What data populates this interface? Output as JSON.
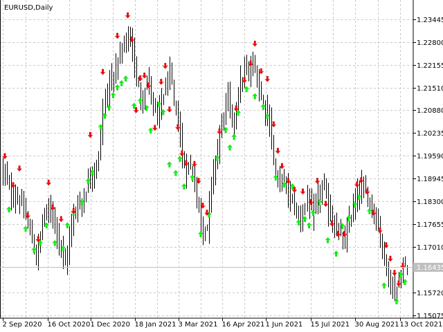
{
  "window": {
    "symbol_title": "EURUSD,Daily"
  },
  "colors": {
    "background": "#ffffff",
    "grid": "#c8c8c8",
    "bar": "#000000",
    "up_arrow": "#00ff00",
    "down_arrow": "#ff0000",
    "price_line": "#c0c0c0",
    "price_tag_bg": "#c0c0c0",
    "price_tag_text": "#ffffff"
  },
  "icons": {
    "up_marker": "green-up-arrow-icon",
    "down_marker": "red-down-arrow-icon"
  },
  "chart_data": {
    "type": "ohlc",
    "title": "EURUSD,Daily",
    "ylim": [
      1.1495,
      1.2385
    ],
    "y_ticks": [
      "1.23445",
      "1.22800",
      "1.22155",
      "1.21510",
      "1.20880",
      "1.20235",
      "1.19590",
      "1.18945",
      "1.18300",
      "1.17655",
      "1.17010",
      "1.16435",
      "1.15720",
      "1.15075"
    ],
    "x_ticks": [
      "2 Sep 2020",
      "16 Oct 2020",
      "1 Dec 2020",
      "18 Jan 2021",
      "3 Mar 2021",
      "16 Apr 2021",
      "1 Jun 2021",
      "15 Jul 2021",
      "30 Aug 2021",
      "13 Oct 2021"
    ],
    "current_price": "1.16435",
    "grid": true,
    "series": [
      {
        "name": "",
        "close_waypoints": [
          [
            0,
            1.192
          ],
          [
            4,
            1.185
          ],
          [
            8,
            1.183
          ],
          [
            12,
            1.177
          ],
          [
            16,
            1.167
          ],
          [
            20,
            1.18
          ],
          [
            24,
            1.18
          ],
          [
            28,
            1.169
          ],
          [
            30,
            1.165
          ],
          [
            34,
            1.18
          ],
          [
            38,
            1.183
          ],
          [
            42,
            1.19
          ],
          [
            46,
            1.195
          ],
          [
            48,
            1.21
          ],
          [
            52,
            1.218
          ],
          [
            56,
            1.224
          ],
          [
            60,
            1.23
          ],
          [
            62,
            1.225
          ],
          [
            64,
            1.218
          ],
          [
            66,
            1.212
          ],
          [
            68,
            1.215
          ],
          [
            70,
            1.217
          ],
          [
            72,
            1.21
          ],
          [
            74,
            1.206
          ],
          [
            76,
            1.212
          ],
          [
            78,
            1.215
          ],
          [
            80,
            1.219
          ],
          [
            82,
            1.211
          ],
          [
            84,
            1.206
          ],
          [
            86,
            1.195
          ],
          [
            88,
            1.192
          ],
          [
            90,
            1.193
          ],
          [
            92,
            1.188
          ],
          [
            94,
            1.18
          ],
          [
            96,
            1.175
          ],
          [
            98,
            1.176
          ],
          [
            100,
            1.188
          ],
          [
            102,
            1.195
          ],
          [
            104,
            1.202
          ],
          [
            106,
            1.208
          ],
          [
            108,
            1.213
          ],
          [
            110,
            1.205
          ],
          [
            112,
            1.211
          ],
          [
            114,
            1.216
          ],
          [
            116,
            1.22
          ],
          [
            118,
            1.219
          ],
          [
            120,
            1.222
          ],
          [
            122,
            1.218
          ],
          [
            124,
            1.212
          ],
          [
            126,
            1.21
          ],
          [
            128,
            1.205
          ],
          [
            130,
            1.195
          ],
          [
            132,
            1.188
          ],
          [
            134,
            1.19
          ],
          [
            136,
            1.187
          ],
          [
            138,
            1.184
          ],
          [
            140,
            1.182
          ],
          [
            142,
            1.178
          ],
          [
            144,
            1.18
          ],
          [
            146,
            1.184
          ],
          [
            148,
            1.179
          ],
          [
            150,
            1.182
          ],
          [
            152,
            1.186
          ],
          [
            154,
            1.187
          ],
          [
            156,
            1.181
          ],
          [
            158,
            1.177
          ],
          [
            160,
            1.175
          ],
          [
            162,
            1.173
          ],
          [
            164,
            1.171
          ],
          [
            166,
            1.178
          ],
          [
            168,
            1.181
          ],
          [
            170,
            1.185
          ],
          [
            172,
            1.187
          ],
          [
            174,
            1.185
          ],
          [
            176,
            1.183
          ],
          [
            178,
            1.18
          ],
          [
            180,
            1.176
          ],
          [
            182,
            1.17
          ],
          [
            184,
            1.164
          ],
          [
            186,
            1.16
          ],
          [
            188,
            1.157
          ],
          [
            190,
            1.16
          ],
          [
            192,
            1.164
          ],
          [
            194,
            1.1643
          ]
        ],
        "up_markers": [
          [
            3,
            1.1815
          ],
          [
            11,
            1.176
          ],
          [
            15,
            1.17
          ],
          [
            18,
            1.172
          ],
          [
            21,
            1.177
          ],
          [
            25,
            1.172
          ],
          [
            29,
            1.1705
          ],
          [
            31,
            1.177
          ],
          [
            34,
            1.1805
          ],
          [
            38,
            1.1835
          ],
          [
            41,
            1.1895
          ],
          [
            43,
            1.192
          ],
          [
            47,
            1.2048
          ],
          [
            49,
            1.208
          ],
          [
            51,
            1.2103
          ],
          [
            53,
            1.2138
          ],
          [
            55,
            1.216
          ],
          [
            57,
            1.2172
          ],
          [
            59,
            1.2185
          ],
          [
            63,
            1.2108
          ],
          [
            66,
            1.2122
          ],
          [
            69,
            1.2102
          ],
          [
            71,
            1.2038
          ],
          [
            75,
            1.2112
          ],
          [
            77,
            1.209
          ],
          [
            80,
            1.1942
          ],
          [
            83,
            1.1918
          ],
          [
            85,
            1.1958
          ],
          [
            87,
            1.188
          ],
          [
            91,
            1.1905
          ],
          [
            95,
            1.1745
          ],
          [
            99,
            1.18
          ],
          [
            103,
            1.196
          ],
          [
            107,
            1.204
          ],
          [
            109,
            1.199
          ],
          [
            111,
            1.202
          ],
          [
            113,
            1.2088
          ],
          [
            117,
            1.2155
          ],
          [
            121,
            1.2135
          ],
          [
            125,
            1.2105
          ],
          [
            127,
            1.2078
          ],
          [
            131,
            1.1905
          ],
          [
            135,
            1.1885
          ],
          [
            139,
            1.188
          ],
          [
            142,
            1.1778
          ],
          [
            145,
            1.1788
          ],
          [
            147,
            1.177
          ],
          [
            149,
            1.1805
          ],
          [
            152,
            1.1835
          ],
          [
            156,
            1.1728
          ],
          [
            160,
            1.169
          ],
          [
            163,
            1.1768
          ],
          [
            166,
            1.179
          ],
          [
            169,
            1.1828
          ],
          [
            171,
            1.185
          ],
          [
            176,
            1.181
          ],
          [
            183,
            1.16
          ],
          [
            189,
            1.1555
          ],
          [
            191,
            1.163
          ],
          [
            193,
            1.161
          ]
        ],
        "down_markers": [
          [
            1,
            1.195
          ],
          [
            5,
            1.1868
          ],
          [
            8,
            1.1915
          ],
          [
            12,
            1.1782
          ],
          [
            17,
            1.1715
          ],
          [
            22,
            1.1875
          ],
          [
            24,
            1.1805
          ],
          [
            28,
            1.1772
          ],
          [
            34,
            1.1795
          ],
          [
            42,
            1.201
          ],
          [
            48,
            1.2188
          ],
          [
            55,
            1.229
          ],
          [
            60,
            1.2348
          ],
          [
            62,
            1.228
          ],
          [
            64,
            1.208
          ],
          [
            66,
            1.217
          ],
          [
            68,
            1.2178
          ],
          [
            70,
            1.215
          ],
          [
            73,
            1.203
          ],
          [
            76,
            1.216
          ],
          [
            78,
            1.2205
          ],
          [
            80,
            1.2082
          ],
          [
            84,
            1.2032
          ],
          [
            86,
            1.1958
          ],
          [
            88,
            1.193
          ],
          [
            92,
            1.1928
          ],
          [
            94,
            1.188
          ],
          [
            96,
            1.181
          ],
          [
            98,
            1.179
          ],
          [
            104,
            1.202
          ],
          [
            112,
            1.2085
          ],
          [
            116,
            1.2165
          ],
          [
            119,
            1.2212
          ],
          [
            121,
            1.2268
          ],
          [
            124,
            1.219
          ],
          [
            127,
            1.2168
          ],
          [
            130,
            1.204
          ],
          [
            132,
            1.1965
          ],
          [
            134,
            1.1922
          ],
          [
            137,
            1.188
          ],
          [
            140,
            1.1855
          ],
          [
            144,
            1.185
          ],
          [
            148,
            1.182
          ],
          [
            151,
            1.188
          ],
          [
            155,
            1.1815
          ],
          [
            158,
            1.176
          ],
          [
            161,
            1.173
          ],
          [
            164,
            1.173
          ],
          [
            170,
            1.187
          ],
          [
            172,
            1.1882
          ],
          [
            175,
            1.185
          ],
          [
            178,
            1.179
          ],
          [
            181,
            1.174
          ],
          [
            184,
            1.1698
          ],
          [
            186,
            1.166
          ],
          [
            188,
            1.162
          ],
          [
            190,
            1.159
          ],
          [
            192,
            1.164
          ]
        ]
      }
    ]
  }
}
